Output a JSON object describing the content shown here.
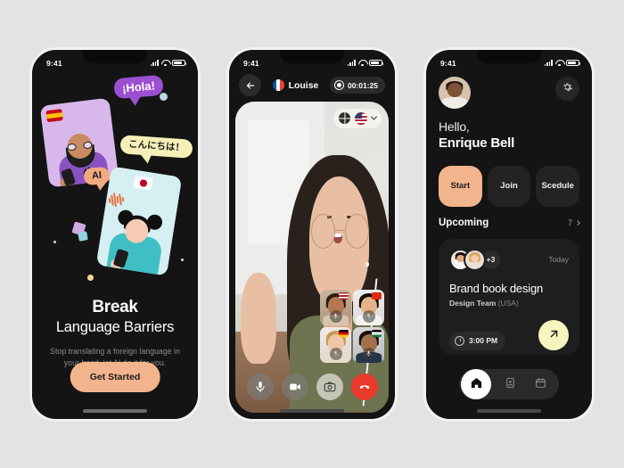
{
  "background_color": "#e3e3e3",
  "accent_peach": "#f2b48c",
  "accent_yellow": "#f7f5bd",
  "screens": {
    "onboarding": {
      "status": {
        "time": "9:41",
        "signal_icon": "cellular-bars-icon",
        "wifi_icon": "wifi-icon",
        "battery_icon": "battery-icon"
      },
      "illustration": {
        "bubble_spanish": "¡Hola!",
        "bubble_japanese": "こんにちは！",
        "bubble_ai": "AI",
        "flag_left": "spain-flag-icon",
        "flag_right": "japan-flag-icon"
      },
      "title_line1": "Break",
      "title_line2": "Language Barriers",
      "subtitle": "Stop translating a foreign language in your head, let AI do it for you.",
      "cta_label": "Get Started"
    },
    "call": {
      "status": {
        "time": "9:41"
      },
      "back_icon": "back-arrow-icon",
      "peer_name": "Louise",
      "peer_flag": "france-flag-icon",
      "timer": "00:01:25",
      "record_icon": "record-icon",
      "language_selector": {
        "translate_icon": "globe-translate-icon",
        "flag": "usa-flag-icon",
        "chevron": "chevron-down-icon"
      },
      "participants": [
        {
          "flag": "usa-flag-icon",
          "mic": "mic-on-icon"
        },
        {
          "flag": "china-flag-icon",
          "mic": "mic-off-icon"
        },
        {
          "flag": "germany-flag-icon",
          "mic": "mic-off-icon"
        },
        {
          "flag": "palestine-flag-icon",
          "mic": "mic-on-icon"
        }
      ],
      "controls": [
        {
          "name": "mic-button",
          "icon": "microphone-icon"
        },
        {
          "name": "video-button",
          "icon": "video-camera-icon"
        },
        {
          "name": "flip-camera-button",
          "icon": "camera-flip-icon"
        },
        {
          "name": "end-call-button",
          "icon": "phone-hangup-icon"
        }
      ]
    },
    "home": {
      "status": {
        "time": "9:41"
      },
      "avatar_name": "user-avatar",
      "settings_icon": "gear-icon",
      "greeting_line1": "Hello,",
      "greeting_line2": "Enrique Bell",
      "actions": [
        {
          "label": "Start",
          "primary": true
        },
        {
          "label": "Join",
          "primary": false
        },
        {
          "label": "Scedule",
          "primary": false
        }
      ],
      "section_title": "Upcoming",
      "section_count": "7",
      "meeting": {
        "extra_attendees": "+3",
        "day": "Today",
        "title": "Brand book design",
        "team": "Design Team",
        "location": "(USA)",
        "time": "3:00 PM",
        "go_icon": "arrow-up-right-icon"
      },
      "tabs": [
        {
          "name": "tab-home",
          "icon": "home-icon",
          "active": true
        },
        {
          "name": "tab-contacts",
          "icon": "contact-card-icon",
          "active": false
        },
        {
          "name": "tab-calendar",
          "icon": "calendar-icon",
          "active": false
        }
      ]
    }
  }
}
